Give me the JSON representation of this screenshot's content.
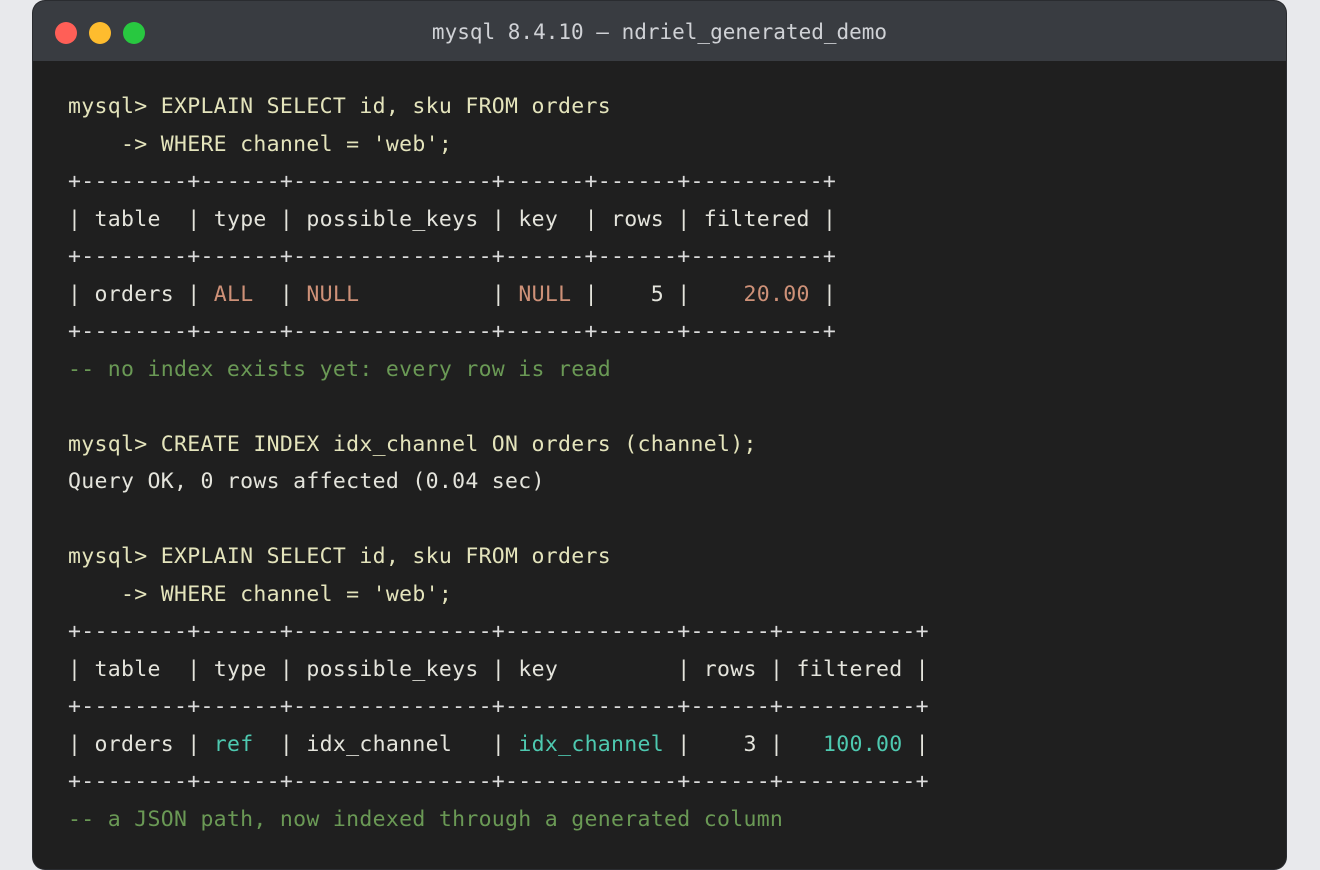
{
  "window": {
    "title": "mysql 8.4.10 — ndriel_generated_demo"
  },
  "colors": {
    "background": "#1f1f1f",
    "titlebar": "#393c41",
    "command": "#e4e4bc",
    "comment": "#6a9955",
    "warn": "#ce9178",
    "good": "#4ec9b0"
  },
  "block1": {
    "prompt_line": "mysql> EXPLAIN SELECT id, sku FROM orders",
    "cont_line": "    -> WHERE channel = 'web';",
    "border": "+--------+------+---------------+------+------+----------+",
    "header": {
      "table": "table ",
      "type": "type",
      "possible_keys": "possible_keys",
      "key": "key ",
      "rows": "rows",
      "filtered": "filtered"
    },
    "row": {
      "table": "orders",
      "type": "ALL ",
      "possible_keys": "NULL         ",
      "key": "NULL",
      "rows": "   5",
      "filtered": "   20.00"
    },
    "comment": "-- no index exists yet: every row is read"
  },
  "block2": {
    "prompt_line": "mysql> CREATE INDEX idx_channel ON orders (channel);",
    "result": "Query OK, 0 rows affected (0.04 sec)"
  },
  "block3": {
    "prompt_line": "mysql> EXPLAIN SELECT id, sku FROM orders",
    "cont_line": "    -> WHERE channel = 'web';",
    "border": "+--------+------+---------------+-------------+------+----------+",
    "header": {
      "table": "table ",
      "type": "type",
      "possible_keys": "possible_keys",
      "key": "key        ",
      "rows": "rows",
      "filtered": "filtered"
    },
    "row": {
      "table": "orders",
      "type": "ref ",
      "possible_keys": "idx_channel  ",
      "key": "idx_channel",
      "rows": "   3",
      "filtered": "  100.00"
    },
    "comment": "-- a JSON path, now indexed through a generated column"
  }
}
